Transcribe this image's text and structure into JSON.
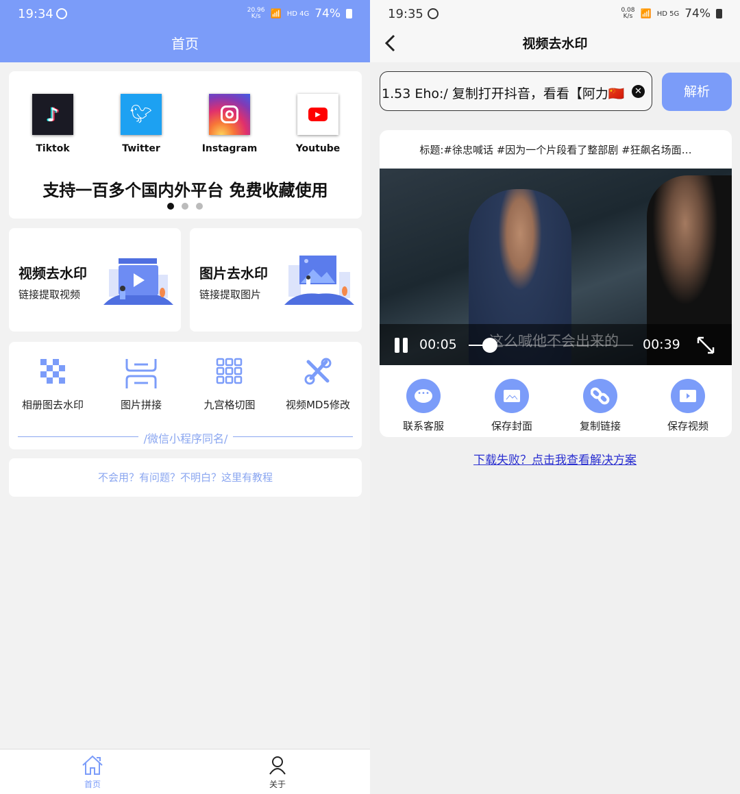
{
  "colors": {
    "accent": "#7b9cf9",
    "link": "#2a2fd0",
    "tutorial_text": "#8aa6f0"
  },
  "left": {
    "status": {
      "time": "19:34",
      "speed": "20.96",
      "speed_unit": "K/s",
      "network": "HD 4G",
      "battery": "74%"
    },
    "header": {
      "title": "首页"
    },
    "platforms": [
      {
        "label": "Tiktok",
        "icon": "tiktok-icon"
      },
      {
        "label": "Twitter",
        "icon": "twitter-icon"
      },
      {
        "label": "Instagram",
        "icon": "instagram-icon"
      },
      {
        "label": "Youtube",
        "icon": "youtube-icon"
      }
    ],
    "banner_tagline": "支持一百多个国内外平台 免费收藏使用",
    "carousel": {
      "pages": 3,
      "active": 1
    },
    "features": [
      {
        "title": "视频去水印",
        "subtitle": "链接提取视频"
      },
      {
        "title": "图片去水印",
        "subtitle": "链接提取图片"
      }
    ],
    "tools": [
      {
        "label": "相册图去水印",
        "icon": "mosaic-icon"
      },
      {
        "label": "图片拼接",
        "icon": "stitch-icon"
      },
      {
        "label": "九宫格切图",
        "icon": "grid-icon"
      },
      {
        "label": "视频MD5修改",
        "icon": "tools-icon"
      }
    ],
    "divider_text": "/微信小程序同名/",
    "tutorial": "不会用？有问题？不明白？这里有教程",
    "tabbar": [
      {
        "label": "首页",
        "icon": "home-icon",
        "active": true
      },
      {
        "label": "关于",
        "icon": "user-icon",
        "active": false
      }
    ]
  },
  "right": {
    "status": {
      "time": "19:35",
      "speed": "0.08",
      "speed_unit": "K/s",
      "network": "HD 5G",
      "battery": "74%"
    },
    "header": {
      "title": "视频去水印"
    },
    "input_value": "1.53 Eho:/ 复制打开抖音，看看【阿力🇨🇳",
    "parse_button": "解析",
    "video_title": "标题:#徐忠喊话 #因为一个片段看了整部剧 #狂飙名场面…",
    "player": {
      "current": "00:05",
      "duration": "00:39",
      "progress": 0.13,
      "subtitle": "这么喊他不会出来的"
    },
    "actions": [
      {
        "label": "联系客服",
        "icon": "chat-icon"
      },
      {
        "label": "保存封面",
        "icon": "image-icon"
      },
      {
        "label": "复制链接",
        "icon": "link-icon"
      },
      {
        "label": "保存视频",
        "icon": "video-icon"
      }
    ],
    "help_link": "下载失败？点击我查看解决方案"
  }
}
